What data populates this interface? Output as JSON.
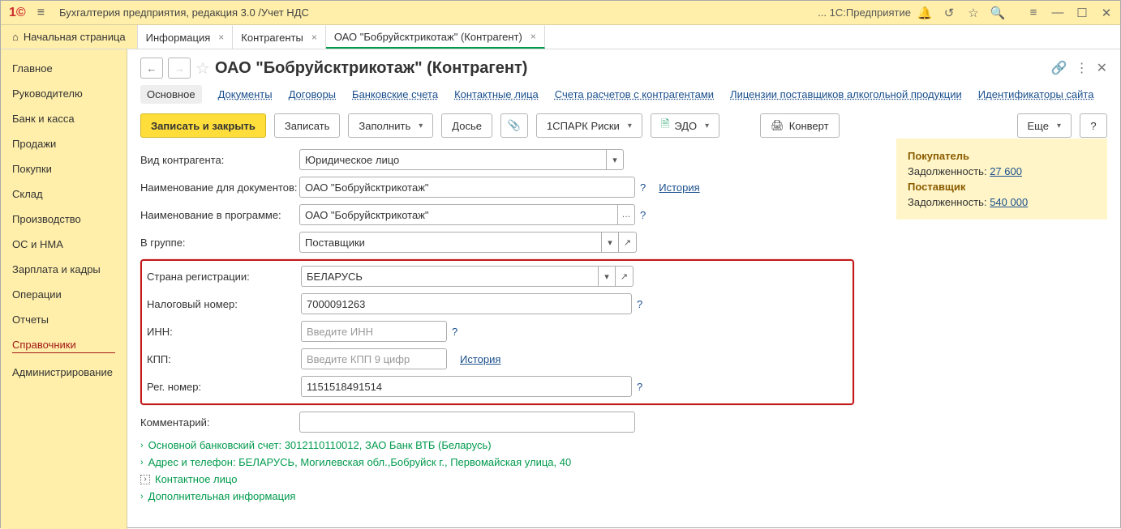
{
  "titlebar": {
    "app_title": "Бухгалтерия предприятия, редакция 3.0 /Учет НДС",
    "right_text": "... 1С:Предприятие"
  },
  "tabs": {
    "home": "Начальная страница",
    "items": [
      {
        "label": "Информация",
        "closeable": true
      },
      {
        "label": "Контрагенты",
        "closeable": true
      },
      {
        "label": "ОАО \"Бобруйсктрикотаж\" (Контрагент)",
        "closeable": true,
        "active": true
      }
    ]
  },
  "sidebar": [
    "Главное",
    "Руководителю",
    "Банк и касса",
    "Продажи",
    "Покупки",
    "Склад",
    "Производство",
    "ОС и НМА",
    "Зарплата и кадры",
    "Операции",
    "Отчеты",
    "Справочники",
    "Администрирование"
  ],
  "sidebar_active_index": 11,
  "page": {
    "title": "ОАО \"Бобруйсктрикотаж\" (Контрагент)"
  },
  "navlinks": [
    "Основное",
    "Документы",
    "Договоры",
    "Банковские счета",
    "Контактные лица",
    "Счета расчетов с контрагентами",
    "Лицензии поставщиков алкогольной продукции",
    "Идентификаторы сайта"
  ],
  "navlinks_active": 0,
  "toolbar": {
    "save_close": "Записать и закрыть",
    "save": "Записать",
    "fill": "Заполнить",
    "dossier": "Досье",
    "spark": "1СПАРК Риски",
    "edo": "ЭДО",
    "envelope": "Конверт",
    "more": "Еще",
    "help": "?"
  },
  "info": {
    "buyer": "Покупатель",
    "debt_label": "Задолженность:",
    "debt_buyer": "27 600",
    "supplier": "Поставщик",
    "debt_supplier": "540 000"
  },
  "form": {
    "type_label": "Вид контрагента:",
    "type_value": "Юридическое лицо",
    "doc_name_label": "Наименование для документов:",
    "doc_name_value": "ОАО \"Бобруйсктрикотаж\"",
    "prog_name_label": "Наименование в программе:",
    "prog_name_value": "ОАО \"Бобруйсктрикотаж\"",
    "group_label": "В группе:",
    "group_value": "Поставщики",
    "country_label": "Страна регистрации:",
    "country_value": "БЕЛАРУСЬ",
    "taxnum_label": "Налоговый номер:",
    "taxnum_value": "7000091263",
    "inn_label": "ИНН:",
    "inn_placeholder": "Введите ИНН",
    "kpp_label": "КПП:",
    "kpp_placeholder": "Введите КПП 9 цифр",
    "reg_label": "Рег. номер:",
    "reg_value": "1151518491514",
    "comment_label": "Комментарий:",
    "history": "История"
  },
  "expand": {
    "bank": "Основной банковский счет: 3012110110012,  ЗАО Банк ВТБ (Беларусь)",
    "addr": "Адрес и телефон: БЕЛАРУСЬ, Могилевская обл.,Бобруйск г., Первомайская улица, 40",
    "contact": "Контактное лицо",
    "other": "Дополнительная информация"
  }
}
